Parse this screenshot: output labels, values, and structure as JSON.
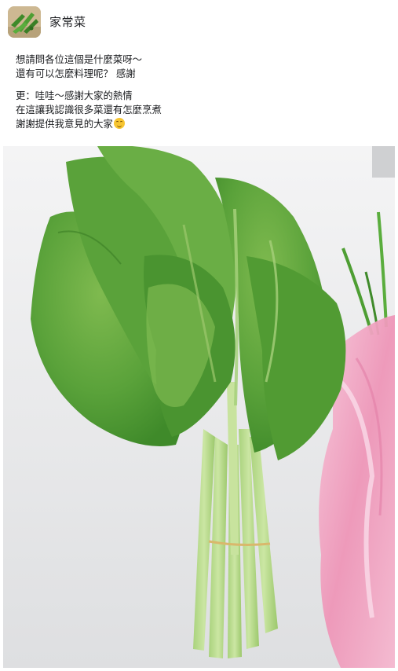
{
  "group": {
    "name": "家常菜",
    "avatar_icon": "vegetable-photo-icon"
  },
  "post": {
    "lines": [
      "想請問各位這個是什麼菜呀～",
      "還有可以怎麼料理呢？ 感謝",
      "更：哇哇～感謝大家的熱情",
      "在這讓我認識很多菜還有怎麼烹煮",
      "謝謝提供我意見的大家"
    ],
    "emoji": "smiling-face-icon"
  },
  "photo": {
    "subject": "leafy-green-vegetable-bundle"
  },
  "colors": {
    "leaf_dark": "#4f9a32",
    "leaf_light": "#8cc35a",
    "stem": "#b6d98a",
    "bag_pink": "#f0a6c3",
    "table": "#e9e9ea"
  }
}
